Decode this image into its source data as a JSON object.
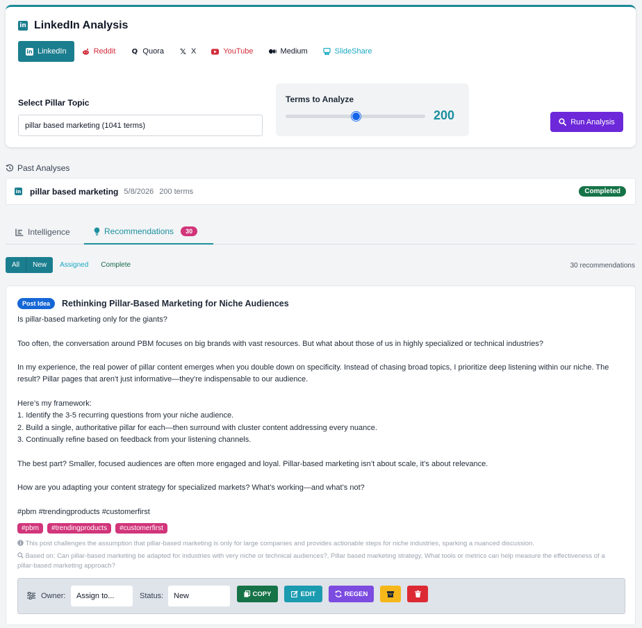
{
  "app": {
    "title": "LinkedIn Analysis"
  },
  "platforms": [
    {
      "label": "LinkedIn",
      "icon": "linkedin-icon",
      "color": "#ffffff",
      "active": true
    },
    {
      "label": "Reddit",
      "icon": "reddit-icon",
      "color": "#d12c3a",
      "active": false
    },
    {
      "label": "Quora",
      "icon": "quora-icon",
      "color": "#111827",
      "active": false
    },
    {
      "label": "X",
      "icon": "x-icon",
      "color": "#111827",
      "active": false
    },
    {
      "label": "YouTube",
      "icon": "youtube-icon",
      "color": "#d12c3a",
      "active": false
    },
    {
      "label": "Medium",
      "icon": "medium-icon",
      "color": "#111827",
      "active": false
    },
    {
      "label": "SlideShare",
      "icon": "slideshare-icon",
      "color": "#19a8c0",
      "active": false
    }
  ],
  "form": {
    "pillar_label": "Select Pillar Topic",
    "pillar_value": "pillar based marketing (1041 terms)",
    "terms_label": "Terms to Analyze",
    "terms_value": "200",
    "terms_fraction": 0.5,
    "run_label": "Run Analysis"
  },
  "past": {
    "heading": "Past Analyses",
    "items": [
      {
        "topic": "pillar based marketing",
        "date": "5/8/2026",
        "terms": "200 terms",
        "status": "Completed"
      }
    ]
  },
  "tabs": [
    {
      "label": "Intelligence",
      "icon": "chart-icon",
      "active": false
    },
    {
      "label": "Recommendations",
      "icon": "lightbulb-icon",
      "active": true,
      "count": "30"
    }
  ],
  "filters": {
    "all": "All",
    "new": "New",
    "assigned": "Assigned",
    "complete": "Complete",
    "count_text": "30 recommendations"
  },
  "recommendation": {
    "badge": "Post Idea",
    "title": "Rethinking Pillar-Based Marketing for Niche Audiences",
    "body": "Is pillar-based marketing only for the giants?\n\nToo often, the conversation around PBM focuses on big brands with vast resources. But what about those of us in highly specialized or technical industries?\n\nIn my experience, the real power of pillar content emerges when you double down on specificity. Instead of chasing broad topics, I prioritize deep listening within our niche. The result? Pillar pages that aren't just informative—they're indispensable to our audience.\n\nHere’s my framework:\n1. Identify the 3-5 recurring questions from your niche audience.\n2. Build a single, authoritative pillar for each—then surround with cluster content addressing every nuance.\n3. Continually refine based on feedback from your listening channels.\n\nThe best part? Smaller, focused audiences are often more engaged and loyal. Pillar-based marketing isn’t about scale, it’s about relevance.\n\nHow are you adapting your content strategy for specialized markets? What’s working—and what’s not?\n\n#pbm #trendingproducts #customerfirst",
    "hashtags": [
      "#pbm",
      "#trendingproducts",
      "#customerfirst"
    ],
    "reason": "This post challenges the assumption that pillar-based marketing is only for large companies and provides actionable steps for niche industries, sparking a nuanced discussion.",
    "based_on": "Based on: Can pillar-based marketing be adapted for industries with very niche or technical audiences?, Pillar based marketing strategy, What tools or metrics can help measure the effectiveness of a pillar-based marketing approach?",
    "owner_label": "Owner:",
    "owner_value": "Assign to...",
    "status_label": "Status:",
    "status_value": "New",
    "copy_label": "COPY",
    "edit_label": "EDIT",
    "regen_label": "REGEN"
  },
  "colors": {
    "teal": "#1b7e8f",
    "purple": "#6d28d9",
    "pink": "#d1357a",
    "green": "#157347",
    "blue": "#1567d6"
  }
}
